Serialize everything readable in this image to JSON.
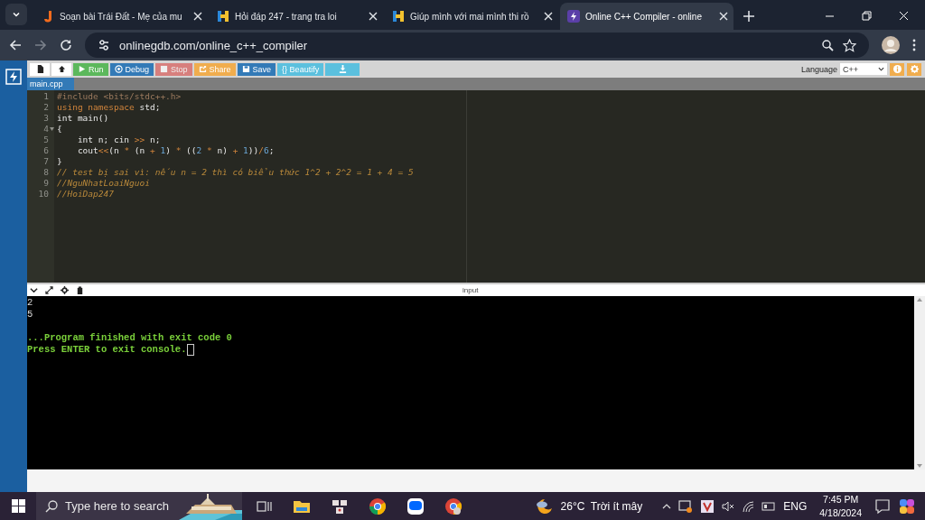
{
  "browser": {
    "tabs": [
      {
        "title": "Soạn bài Trái Đất - Mẹ của mu",
        "kind": "j",
        "selected": false
      },
      {
        "title": "Hỏi đáp 247 - trang tra loi",
        "kind": "h",
        "selected": false
      },
      {
        "title": "Giúp mình với mai mình thi rồ",
        "kind": "h",
        "selected": false
      },
      {
        "title": "Online C++ Compiler - online",
        "kind": "bolt",
        "selected": true
      }
    ],
    "url": "onlinegdb.com/online_c++_compiler"
  },
  "toolbar": {
    "buttons": [
      {
        "kind": "new",
        "disabled": false
      },
      {
        "kind": "open",
        "disabled": false
      },
      {
        "kind": "run",
        "label": "Run",
        "disabled": false
      },
      {
        "kind": "debug",
        "label": "Debug",
        "disabled": false
      },
      {
        "kind": "stop",
        "label": "Stop",
        "disabled": true
      },
      {
        "kind": "share",
        "label": "Share",
        "disabled": false
      },
      {
        "kind": "save",
        "label": "Save",
        "disabled": false
      },
      {
        "kind": "beautify",
        "label": "{} Beautify",
        "disabled": false
      },
      {
        "kind": "download",
        "disabled": false
      }
    ],
    "language_label": "Language",
    "language": "C++"
  },
  "file_tab": "main.cpp",
  "editor": {
    "lines": [
      {
        "number": "1",
        "fold": false,
        "tokens": [
          {
            "text": "#include <bits/stdc++.h>",
            "kind": "pre"
          }
        ]
      },
      {
        "number": "2",
        "fold": false,
        "tokens": [
          {
            "text": "using namespace",
            "kind": "kw"
          },
          {
            "text": " std;",
            "kind": "id"
          }
        ]
      },
      {
        "number": "3",
        "fold": false,
        "tokens": [
          {
            "text": "int main()",
            "kind": "id"
          }
        ]
      },
      {
        "number": "4",
        "fold": true,
        "tokens": [
          {
            "text": "{",
            "kind": "id"
          }
        ]
      },
      {
        "number": "5",
        "fold": false,
        "tokens": [
          {
            "text": "    int n; cin ",
            "kind": "id"
          },
          {
            "text": ">>",
            "kind": "op"
          },
          {
            "text": " n;",
            "kind": "id"
          }
        ]
      },
      {
        "number": "6",
        "fold": false,
        "tokens": [
          {
            "text": "    cout",
            "kind": "id"
          },
          {
            "text": "<<",
            "kind": "op"
          },
          {
            "text": "(n ",
            "kind": "id"
          },
          {
            "text": "*",
            "kind": "op"
          },
          {
            "text": " (n ",
            "kind": "id"
          },
          {
            "text": "+ ",
            "kind": "op"
          },
          {
            "text": "1",
            "kind": "num"
          },
          {
            "text": ") ",
            "kind": "id"
          },
          {
            "text": "*",
            "kind": "op"
          },
          {
            "text": " ((",
            "kind": "id"
          },
          {
            "text": "2 ",
            "kind": "num"
          },
          {
            "text": "*",
            "kind": "op"
          },
          {
            "text": " n) ",
            "kind": "id"
          },
          {
            "text": "+ ",
            "kind": "op"
          },
          {
            "text": "1",
            "kind": "num"
          },
          {
            "text": "))",
            "kind": "id"
          },
          {
            "text": "/",
            "kind": "op"
          },
          {
            "text": "6",
            "kind": "num"
          },
          {
            "text": ";",
            "kind": "id"
          }
        ]
      },
      {
        "number": "7",
        "fold": false,
        "tokens": [
          {
            "text": "}",
            "kind": "id"
          }
        ]
      },
      {
        "number": "8",
        "fold": false,
        "tokens": [
          {
            "text": "// test bị sai vì: nếu n = 2 thì có biểu thức 1^2 + 2^2 = 1 + 4 = 5",
            "kind": "comment"
          }
        ]
      },
      {
        "number": "9",
        "fold": false,
        "tokens": [
          {
            "text": "//NguNhatLoaiNguoi",
            "kind": "comment"
          }
        ]
      },
      {
        "number": "10",
        "fold": false,
        "tokens": [
          {
            "text": "//HoiDap247",
            "kind": "comment"
          }
        ]
      }
    ]
  },
  "output": {
    "header_label": "input",
    "echo": [
      "2",
      "5"
    ],
    "messages": [
      "...Program finished with exit code 0",
      "Press ENTER to exit console."
    ]
  },
  "taskbar": {
    "search_placeholder": "Type here to search",
    "weather": "26°C  Trời ít mây",
    "language": "ENG",
    "time": "7:45 PM",
    "date": "4/18/2024"
  }
}
